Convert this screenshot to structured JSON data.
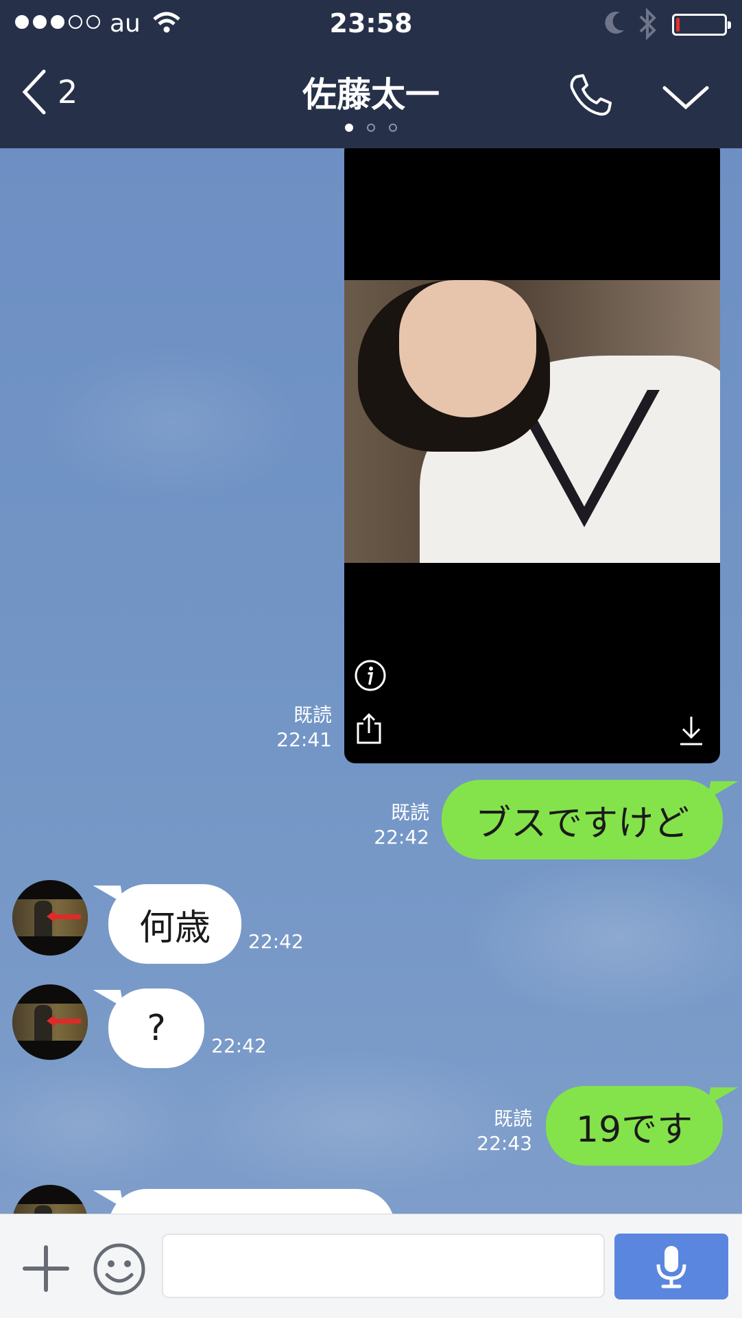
{
  "status_bar": {
    "carrier": "au",
    "time": "23:58",
    "signal_bars_filled": 3,
    "signal_bars_total": 5,
    "battery_level_fraction": 0.08,
    "battery_color": "#e4322b"
  },
  "header": {
    "back_count": "2",
    "title": "佐藤太一",
    "page_dots": 3,
    "active_page": 1
  },
  "messages": [
    {
      "type": "image",
      "direction": "out",
      "read_label": "既読",
      "time": "22:41"
    },
    {
      "type": "text",
      "direction": "out",
      "text": "ブスですけど",
      "read_label": "既読",
      "time": "22:42"
    },
    {
      "type": "text",
      "direction": "in",
      "text": "何歳",
      "time": "22:42"
    },
    {
      "type": "text",
      "direction": "in",
      "text": "?",
      "time": "22:42"
    },
    {
      "type": "text",
      "direction": "out",
      "text": "19です",
      "read_label": "既読",
      "time": "22:43"
    }
  ],
  "input": {
    "value": "",
    "placeholder": ""
  },
  "colors": {
    "nav_bg": "#263149",
    "outgoing_bubble": "#84e34a",
    "incoming_bubble": "#ffffff",
    "mic_button": "#5a86e0"
  },
  "icons": [
    "back-chevron-icon",
    "wifi-icon",
    "moon-icon",
    "bluetooth-icon",
    "battery-icon",
    "phone-icon",
    "chevron-down-icon",
    "info-icon",
    "share-icon",
    "download-icon",
    "plus-icon",
    "emoji-icon",
    "microphone-icon"
  ]
}
